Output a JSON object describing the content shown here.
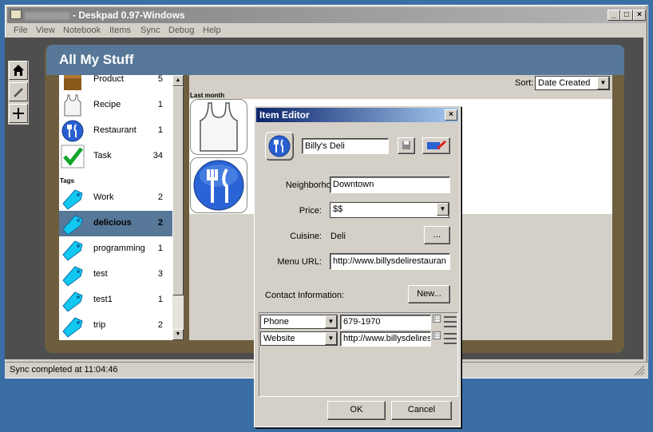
{
  "window": {
    "title": "- Deskpad 0.97-Windows",
    "controls": {
      "minimize": "_",
      "maximize": "□",
      "close": "×"
    }
  },
  "menu": [
    "File",
    "View",
    "Notebook",
    "Items",
    "Sync",
    "Debug",
    "Help"
  ],
  "header": {
    "title": "All My Stuff"
  },
  "toolbox": {
    "home": "home-icon",
    "edit": "pencil-icon",
    "add": "plus-icon"
  },
  "categories": [
    {
      "label": "Product",
      "count": "5",
      "icon": "box-icon"
    },
    {
      "label": "Recipe",
      "count": "1",
      "icon": "apron-icon"
    },
    {
      "label": "Restaurant",
      "count": "1",
      "icon": "fork-knife-icon"
    },
    {
      "label": "Task",
      "count": "34",
      "icon": "checkmark-icon"
    }
  ],
  "tags_heading": "Tags",
  "tags": [
    {
      "label": "Work",
      "count": "2"
    },
    {
      "label": "delicious",
      "count": "2",
      "selected": true
    },
    {
      "label": "programming",
      "count": "1"
    },
    {
      "label": "test",
      "count": "3"
    },
    {
      "label": "test1",
      "count": "1"
    },
    {
      "label": "trip",
      "count": "2"
    }
  ],
  "content": {
    "sort_label": "Sort:",
    "sort_value": "Date Created",
    "group_label": "Last month"
  },
  "status": {
    "text": "Sync completed at 11:04:46"
  },
  "editor": {
    "title": "Item Editor",
    "close": "×",
    "name_value": "Billy's Deli",
    "neighborhood_label": "Neighborhood:",
    "neighborhood_value": "Downtown",
    "price_label": "Price:",
    "price_value": "$$",
    "cuisine_label": "Cuisine:",
    "cuisine_value": "Deli",
    "cuisine_button": "...",
    "menu_url_label": "Menu URL:",
    "menu_url_value": "http://www.billysdelirestauran",
    "contact_label": "Contact Information:",
    "new_button": "New...",
    "contacts": [
      {
        "type": "Phone",
        "value": "679-1970"
      },
      {
        "type": "Website",
        "value": "http://www.billysdelires"
      }
    ],
    "ok": "OK",
    "cancel": "Cancel"
  },
  "colors": {
    "header": "#577898",
    "frame": "#6e5e3d",
    "selection": "#577898",
    "dialog_title": "#0a246a"
  }
}
